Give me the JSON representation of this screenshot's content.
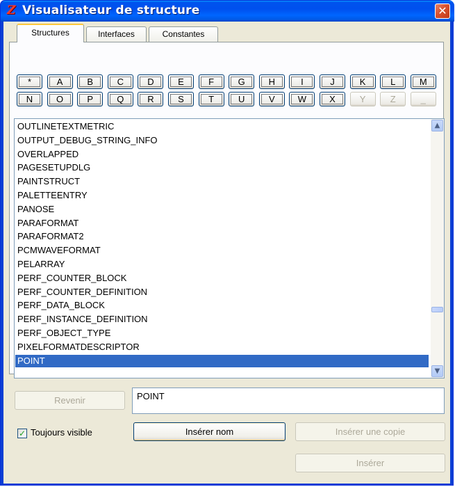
{
  "window": {
    "title": "Visualisateur de structure",
    "app_icon": "Z",
    "close_glyph": "✕"
  },
  "tabs": [
    {
      "label": "Structures",
      "active": true
    },
    {
      "label": "Interfaces",
      "active": false
    },
    {
      "label": "Constantes",
      "active": false
    }
  ],
  "letters_row1": [
    "*",
    "A",
    "B",
    "C",
    "D",
    "E",
    "F",
    "G",
    "H",
    "I",
    "J",
    "K",
    "L",
    "M"
  ],
  "letters_row2": [
    "N",
    "O",
    "P",
    "Q",
    "R",
    "S",
    "T",
    "U",
    "V",
    "W",
    "X",
    "Y",
    "Z",
    "_"
  ],
  "disabled_letters": [
    "Y",
    "Z",
    "_"
  ],
  "list": {
    "items": [
      "OUTLINETEXTMETRIC",
      "OUTPUT_DEBUG_STRING_INFO",
      "OVERLAPPED",
      "PAGESETUPDLG",
      "PAINTSTRUCT",
      "PALETTEENTRY",
      "PANOSE",
      "PARAFORMAT",
      "PARAFORMAT2",
      "PCMWAVEFORMAT",
      "PELARRAY",
      "PERF_COUNTER_BLOCK",
      "PERF_COUNTER_DEFINITION",
      "PERF_DATA_BLOCK",
      "PERF_INSTANCE_DEFINITION",
      "PERF_OBJECT_TYPE",
      "PIXELFORMATDESCRIPTOR",
      "POINT"
    ],
    "selected": "POINT",
    "scroll_up": "▲",
    "scroll_down": "▼"
  },
  "buttons": {
    "revenir": "Revenir",
    "inserer_nom": "Insérer nom",
    "inserer_copie": "Insérer une copie",
    "inserer": "Insérer"
  },
  "name_field": {
    "value": "POINT"
  },
  "always_visible": {
    "label": "Toujours visible",
    "checked": true,
    "check_glyph": "✓"
  },
  "colors": {
    "selection": "#316ac5",
    "titlebar": "#0053ee",
    "face": "#ece9d8"
  }
}
